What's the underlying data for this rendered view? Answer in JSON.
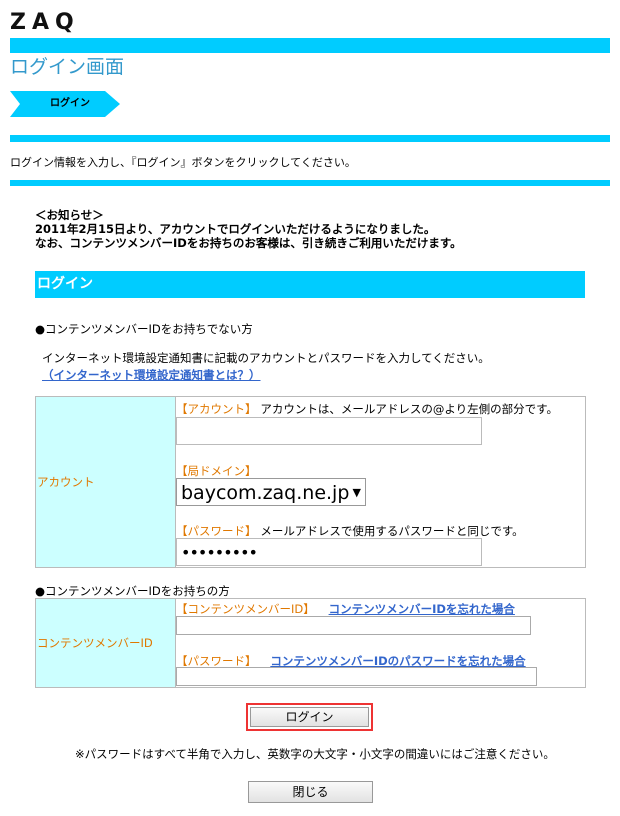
{
  "brand": {
    "logo": "ZAQ"
  },
  "page": {
    "title": "ログイン画面",
    "step": "ログイン",
    "instruction": "ログイン情報を入力し、『ログイン』ボタンをクリックしてください。"
  },
  "notice": {
    "line1": "＜お知らせ＞",
    "line2": "2011年2月15日より、アカウントでログインいただけるようになりました。",
    "line3": "なお、コンテンツメンバーIDをお持ちのお客様は、引き続きご利用いただけます。"
  },
  "login_section": {
    "title": "ログイン",
    "no_member_heading": "●コンテンツメンバーIDをお持ちでない方",
    "description": "インターネット環境設定通知書に記載のアカウントとパスワードを入力してください。",
    "help_link": "（インターネット環境設定通知書とは？）"
  },
  "account_form": {
    "row_label": "アカウント",
    "account_label": "【アカウント】",
    "account_note": "アカウントは、メールアドレスの@より左側の部分です。",
    "account_value": "",
    "domain_label": "【局ドメイン】",
    "domain_value": "baycom.zaq.ne.jp",
    "password_label": "【パスワード】",
    "password_note": "メールアドレスで使用するパスワードと同じです。",
    "password_value": "•••••••••"
  },
  "member_form": {
    "heading": "●コンテンツメンバーIDをお持ちの方",
    "row_label": "コンテンツメンバーID",
    "id_label": "【コンテンツメンバーID】",
    "id_forgot_link": "コンテンツメンバーIDを忘れた場合",
    "password_label": "【パスワード】",
    "password_forgot_link": "コンテンツメンバーIDのパスワードを忘れた場合"
  },
  "buttons": {
    "login": "ログイン",
    "close": "閉じる"
  },
  "footnote": "※パスワードはすべて半角で入力し、英数字の大文字・小文字の間違いにはご注意ください。",
  "colors": {
    "accent": "#00ccff",
    "label_bg": "#ccffff",
    "label_text": "#e07800",
    "link": "#3366cc",
    "highlight": "#ee3333"
  },
  "icons": {
    "select_caret": "caret-down-icon",
    "step_arrow": "chevron-arrow-icon"
  }
}
